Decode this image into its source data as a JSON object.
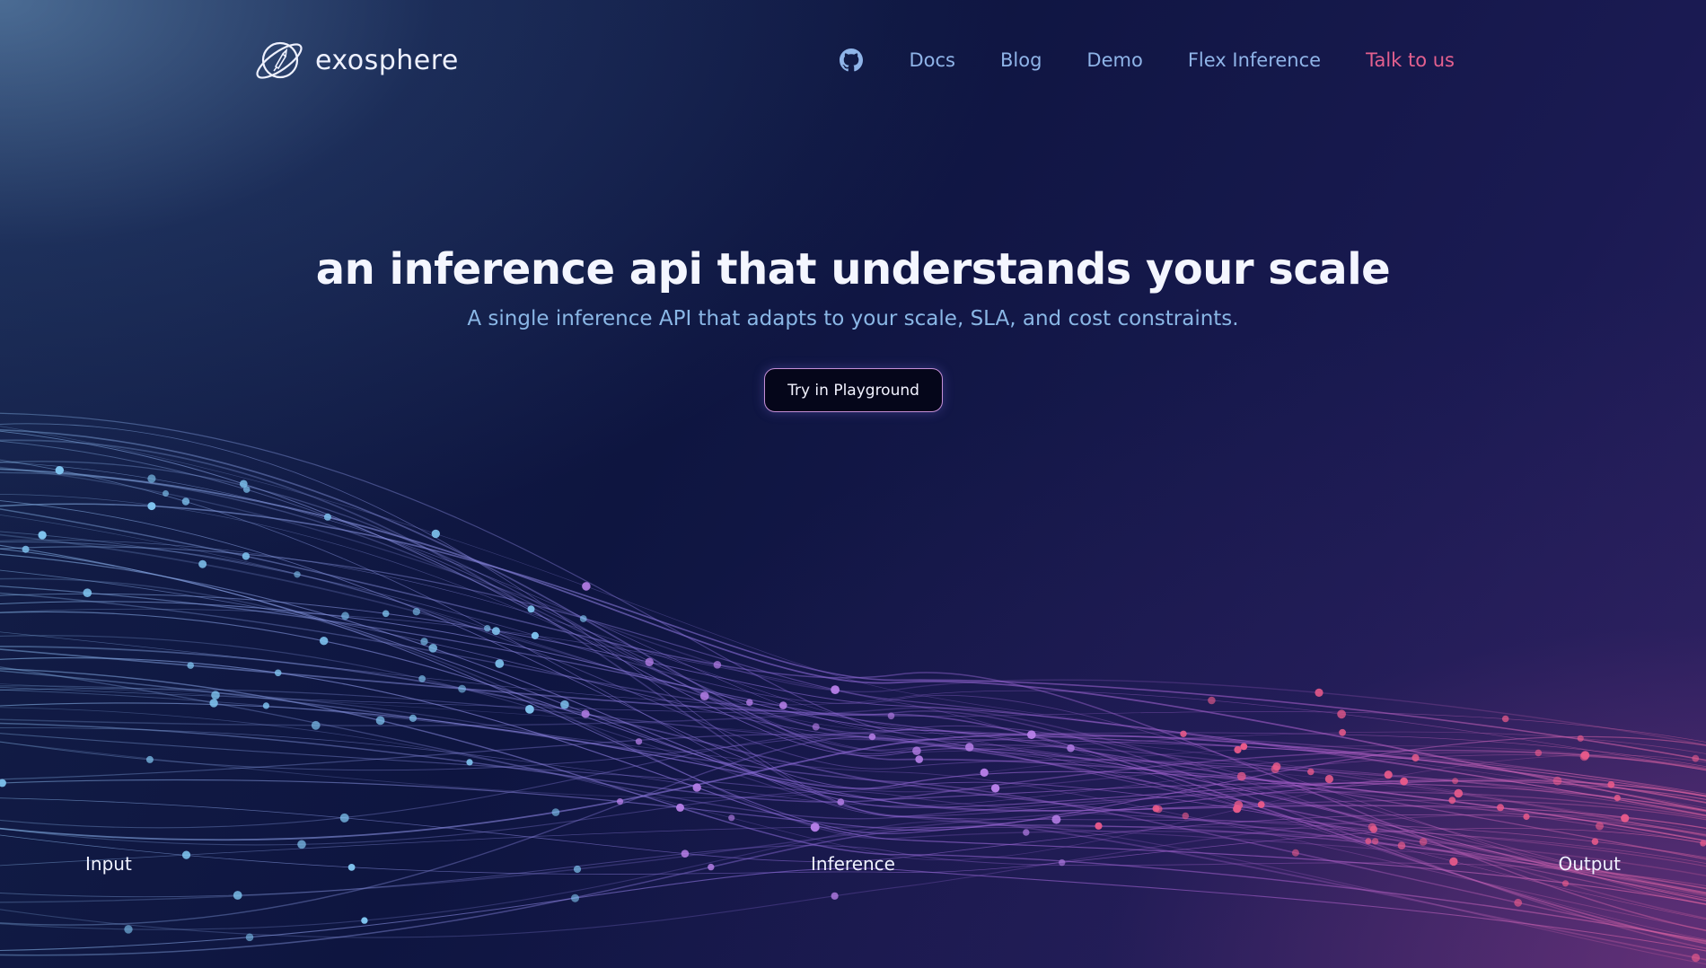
{
  "brand": {
    "name": "exosphere"
  },
  "nav": {
    "github_icon": "github-icon",
    "links": [
      "Docs",
      "Blog",
      "Demo",
      "Flex Inference"
    ],
    "cta": "Talk to us"
  },
  "hero": {
    "title": "an inference api that understands your scale",
    "subtitle": "A single inference API that adapts to your scale, SLA, and cost constraints.",
    "button": "Try in Playground"
  },
  "stages": {
    "input": "Input",
    "inference": "Inference",
    "output": "Output"
  },
  "colors": {
    "background": "#0f1641",
    "nav_link": "#8fb4e8",
    "nav_cta": "#e4608f",
    "subtitle": "#8ab7e6",
    "dots_input": "#7fc4ef",
    "dots_inference": "#b77fe8",
    "dots_output": "#e85a8a"
  }
}
